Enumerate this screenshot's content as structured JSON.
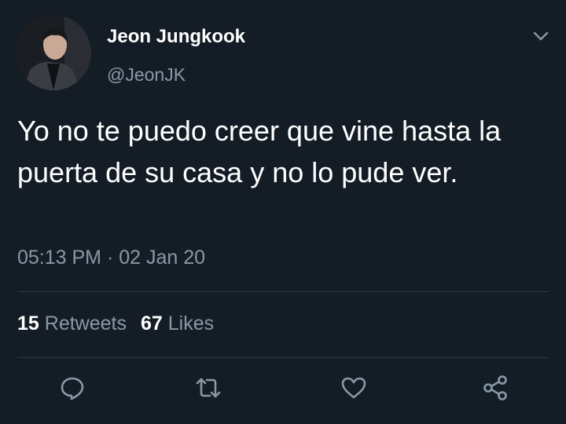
{
  "user": {
    "name": "Jeon Jungkook",
    "handle": "@JeonJK"
  },
  "tweet": {
    "text": "Yo no te puedo creer que vine hasta la puerta de su casa y no lo pude ver.",
    "timestamp": "05:13 PM · 02 Jan 20"
  },
  "stats": {
    "retweets_count": "15",
    "retweets_label": "Retweets",
    "likes_count": "67",
    "likes_label": "Likes"
  },
  "actions": [
    "reply-icon",
    "retweet-icon",
    "like-icon",
    "share-icon"
  ],
  "colors": {
    "background": "#141d26",
    "text": "#ffffff",
    "muted": "#8899a6",
    "divider": "#2f3b47"
  }
}
